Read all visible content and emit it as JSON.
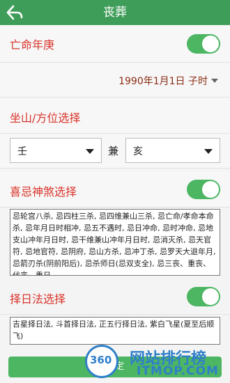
{
  "header": {
    "title": "丧葬"
  },
  "death_year": {
    "label": "亡命年庚",
    "enabled": true,
    "date_value": "1990年1月1日 子时"
  },
  "mountain": {
    "label": "坐山/方位选择",
    "left_value": "壬",
    "connector": "兼",
    "right_value": "亥"
  },
  "shensha": {
    "label": "喜忌神煞选择",
    "enabled": true,
    "text": "忌轮宫八杀, 忌四柱三杀, 忌四维兼山三杀, 忌亡命/孝命本命杀, 忌年月日时相冲, 忌五不遇时, 忌日冲命, 忌时冲命, 忌地支山冲年月日时, 忌干维兼山冲年月日时, 忌消灭杀, 忌天官符, 忌地官符, 忌阴府, 忌山方杀, 忌冲丁杀, 忌罗天大退年月, 忌箭刃杀(阴前阳后), 忌杀师日(忌双支全), 忌三丧、重丧、伏丧、重日"
  },
  "date_method": {
    "label": "择日法选择",
    "enabled": true,
    "text": "吉星择日法, 斗首择日法, 正五行择日法, 紫白飞星(夏至后顺飞)"
  },
  "confirm_label": "确定",
  "watermark": {
    "number": "360",
    "cn": "网站排行榜",
    "en": "ITMOP.COM"
  },
  "colors": {
    "header_bg": "#3f9d5a",
    "accent_red": "#d9342b",
    "toggle_green": "#4cb663",
    "date_color": "#8b2c13"
  }
}
